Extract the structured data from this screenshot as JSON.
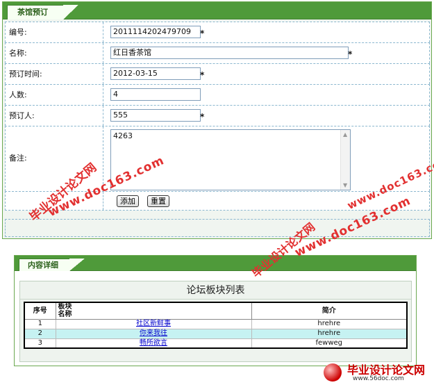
{
  "panel1": {
    "tab_title": "茶馆预订",
    "fields": [
      {
        "label": "编号:",
        "value": "2011114202479709",
        "required": "*"
      },
      {
        "label": "名称:",
        "value": "红日香茶馆",
        "required": "*"
      },
      {
        "label": "预订时间:",
        "value": "2012-03-15",
        "required": "*"
      },
      {
        "label": "人数:",
        "value": "4",
        "required": ""
      },
      {
        "label": "预订人:",
        "value": "555",
        "required": "*"
      }
    ],
    "remark": {
      "label": "备注:",
      "value": "4263"
    },
    "buttons": {
      "add": "添加",
      "reset": "重置"
    }
  },
  "panel2": {
    "tab_title": "内容详细",
    "caption": "论坛板块列表",
    "headers": {
      "index": "序号",
      "name": "板块名称",
      "intro": "简介"
    },
    "rows": [
      {
        "index": "1",
        "name": "社区新鲜事",
        "intro": "hrehre"
      },
      {
        "index": "2",
        "name": "你来我往",
        "intro": "hrehre"
      },
      {
        "index": "3",
        "name": "畅所欲言",
        "intro": "fewweg"
      }
    ]
  },
  "watermark": {
    "text_cn": "毕业设计论文网",
    "text_url": "www.doc163.com",
    "logo_title": "毕业设计论文网",
    "logo_url": "www.56doc.com"
  },
  "colors": {
    "accent_green": "#4f9a3a",
    "link": "#0000cc",
    "highlight_row": "#c6f2f2",
    "watermark": "#e23030"
  }
}
